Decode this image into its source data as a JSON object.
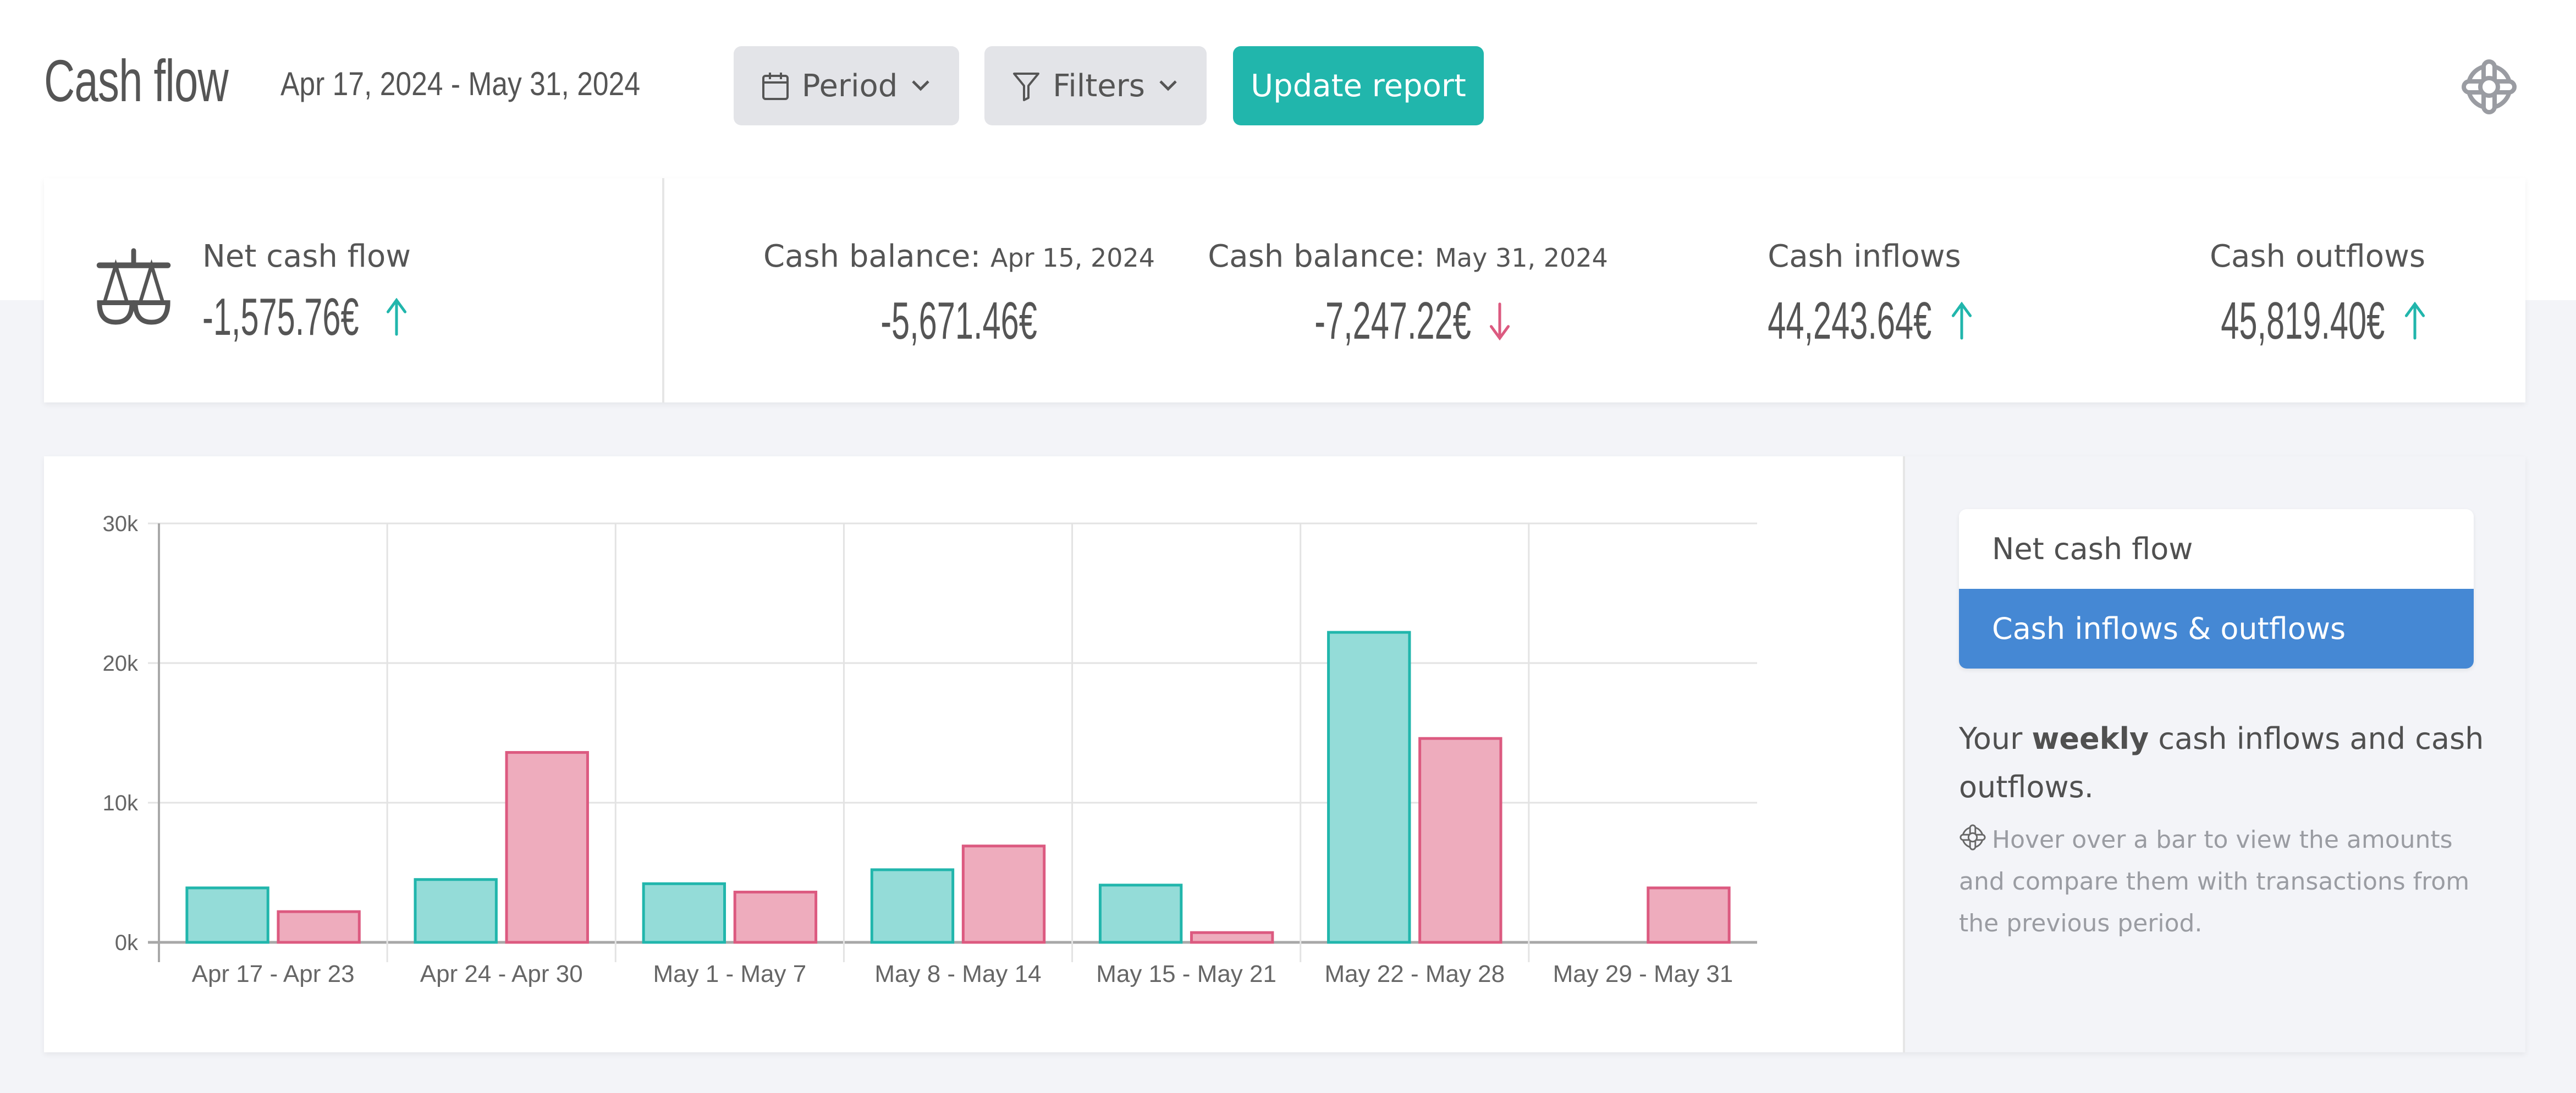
{
  "header": {
    "title": "Cash flow",
    "date_range": "Apr 17, 2024 - May 31, 2024",
    "period_button": "Period",
    "filters_button": "Filters",
    "update_button": "Update report",
    "help_icon": "lifebuoy-icon"
  },
  "colors": {
    "accent_teal": "#21b6ac",
    "inflow_fill": "#92dbd7",
    "outflow_stroke": "#dc5a80",
    "outflow_fill": "#eeaabc",
    "selected_blue": "#4588d4",
    "up_arrow": "#21b6ac",
    "down_arrow": "#dc5a80"
  },
  "summary": {
    "net_cash_flow": {
      "label": "Net cash flow",
      "value": "-1,575.76€",
      "trend": "up"
    },
    "balance_start": {
      "label": "Cash balance:",
      "date": "Apr 15, 2024",
      "value": "-5,671.46€"
    },
    "balance_end": {
      "label": "Cash balance:",
      "date": "May 31, 2024",
      "value": "-7,247.22€",
      "trend": "down"
    },
    "inflows": {
      "label": "Cash inflows",
      "value": "44,243.64€",
      "trend": "up"
    },
    "outflows": {
      "label": "Cash outflows",
      "value": "45,819.40€",
      "trend": "up"
    }
  },
  "side_panel": {
    "options": [
      {
        "label": "Net cash flow",
        "selected": false
      },
      {
        "label": "Cash inflows & outflows",
        "selected": true
      }
    ],
    "description_pre": "Your ",
    "description_bold": "weekly",
    "description_post": " cash inflows and cash outflows.",
    "hint": "Hover over a bar to view the amounts and compare them with transactions from the previous period."
  },
  "chart_data": {
    "type": "bar",
    "title": "",
    "xlabel": "",
    "ylabel": "",
    "ylim": [
      0,
      30000
    ],
    "yticks": [
      0,
      10000,
      20000,
      30000
    ],
    "ytick_labels": [
      "0k",
      "10k",
      "20k",
      "30k"
    ],
    "grid": true,
    "categories": [
      "Apr 17 - Apr 23",
      "Apr 24 - Apr 30",
      "May 1 - May 7",
      "May 8 - May 14",
      "May 15 - May 21",
      "May 22 - May 28",
      "May 29 - May 31"
    ],
    "series": [
      {
        "name": "Cash inflows",
        "values": [
          3900,
          4500,
          4200,
          5200,
          4100,
          22200,
          0
        ]
      },
      {
        "name": "Cash outflows",
        "values": [
          2200,
          13600,
          3600,
          6900,
          700,
          14600,
          3900
        ]
      }
    ]
  }
}
